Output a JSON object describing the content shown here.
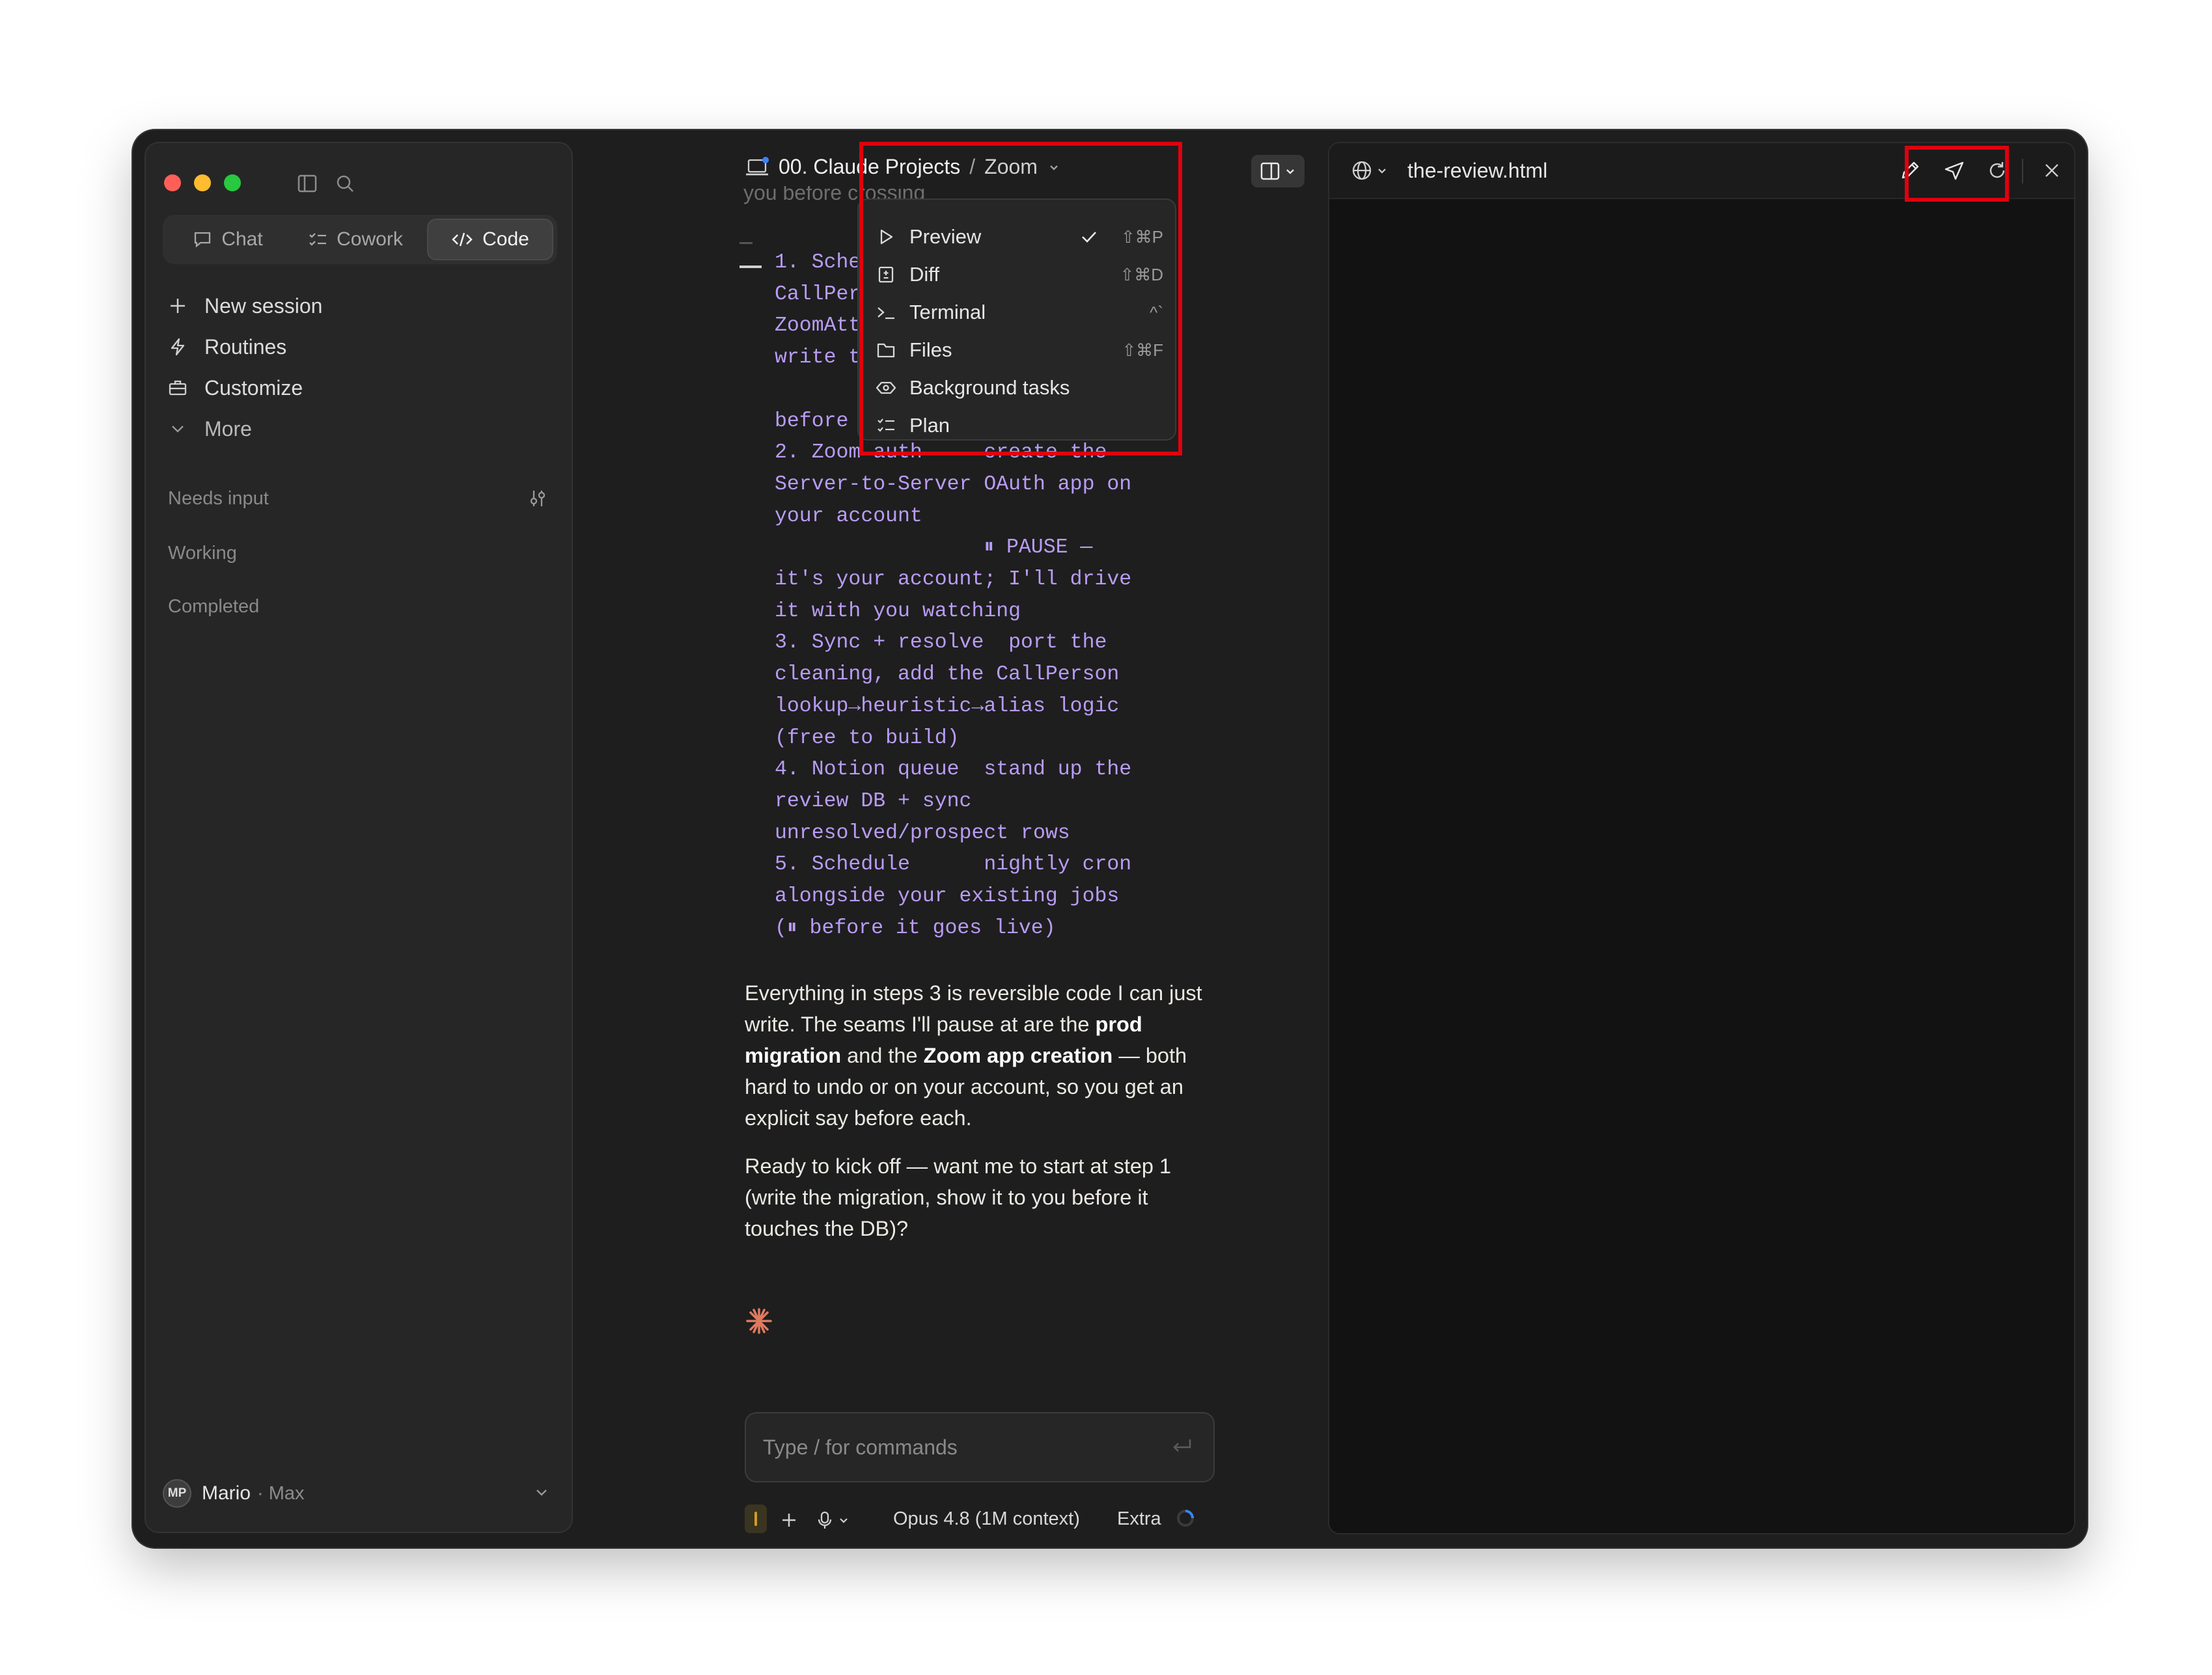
{
  "sidebar": {
    "modes": [
      {
        "label": "Chat",
        "icon": "chat-bubble-icon"
      },
      {
        "label": "Cowork",
        "icon": "checklist-icon"
      },
      {
        "label": "Code",
        "icon": "code-icon",
        "active": true
      }
    ],
    "nav": [
      {
        "label": "New session",
        "icon": "plus-icon"
      },
      {
        "label": "Routines",
        "icon": "lightning-icon"
      },
      {
        "label": "Customize",
        "icon": "briefcase-icon"
      },
      {
        "label": "More",
        "icon": "chevron-down-icon"
      }
    ],
    "sections": {
      "needs_input": "Needs input",
      "working": "Working",
      "completed": "Completed"
    },
    "user": {
      "initials": "MP",
      "name": "Mario",
      "plan": "· Max"
    }
  },
  "chat": {
    "breadcrumb": {
      "project": "00. Claude Projects",
      "separator": "/",
      "session": "Zoom"
    },
    "clipped_line": "you before crossing",
    "code_lines": [
      "1. Schema",
      "CallPerson + Z",
      "ZoomAttendance",
      "write the migr",
      "",
      "before applyin",
      "2. Zoom auth     create the",
      "Server-to-Server OAuth app on",
      "your account",
      "                 ⏸ PAUSE —",
      "it's your account; I'll drive",
      "it with you watching",
      "3. Sync + resolve  port the",
      "cleaning, add the CallPerson",
      "lookup→heuristic→alias logic",
      "(free to build)",
      "4. Notion queue  stand up the",
      "review DB + sync",
      "unresolved/prospect rows",
      "5. Schedule      nightly cron",
      "alongside your existing jobs",
      "(⏸ before it goes live)"
    ],
    "para1": {
      "t1": "Everything in steps 3 is reversible code I can just write. The seams I'll pause at are the ",
      "b1": "prod migration",
      "t2": " and the ",
      "b2": "Zoom app creation",
      "t3": " — both hard to undo or on your account, so you get an explicit say before each."
    },
    "para2": "Ready to kick off — want me to start at step 1 (write the migration, show it to you before it touches the DB)?",
    "input_placeholder": "Type / for commands",
    "model": "Opus 4.8 (1M context)",
    "effort": "Extra"
  },
  "view_menu": {
    "items": [
      {
        "label": "Preview",
        "icon": "play-icon",
        "checked": true,
        "shortcut": "⇧⌘P"
      },
      {
        "label": "Diff",
        "icon": "diff-icon",
        "shortcut": "⇧⌘D"
      },
      {
        "label": "Terminal",
        "icon": "terminal-icon",
        "shortcut": "^`"
      },
      {
        "label": "Files",
        "icon": "folder-icon",
        "shortcut": "⇧⌘F"
      },
      {
        "label": "Background tasks",
        "icon": "tasks-icon",
        "shortcut": ""
      },
      {
        "label": "Plan",
        "icon": "plan-icon",
        "shortcut": ""
      }
    ]
  },
  "preview": {
    "filename": "the-review.html"
  },
  "colors": {
    "window_bg": "#1e1e1e",
    "code_text": "#b99cf5",
    "highlight_box": "#e0000e",
    "spinner_accent": "#e07a5f"
  }
}
